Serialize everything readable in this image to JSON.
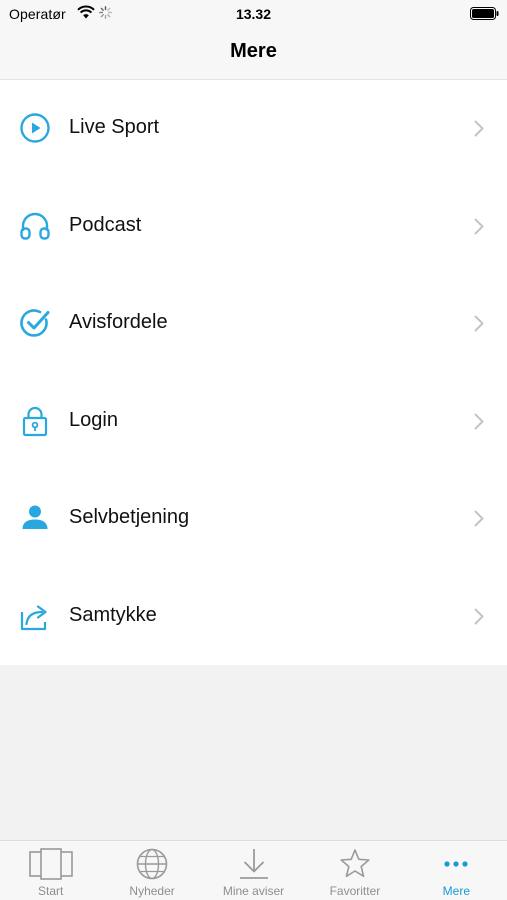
{
  "status_bar": {
    "carrier": "Operatør",
    "time": "13.32"
  },
  "header": {
    "title": "Mere"
  },
  "colors": {
    "accent": "#1a9ad6",
    "icon_blue": "#29a8e0",
    "chevron": "#c4c4c6",
    "tab_inactive": "#8e8e8e"
  },
  "menu": {
    "items": [
      {
        "label": "Live Sport",
        "icon": "play-circle-icon"
      },
      {
        "label": "Podcast",
        "icon": "headphones-icon"
      },
      {
        "label": "Avisfordele",
        "icon": "check-circle-icon"
      },
      {
        "label": "Login",
        "icon": "lock-icon"
      },
      {
        "label": "Selvbetjening",
        "icon": "person-icon"
      },
      {
        "label": "Samtykke",
        "icon": "share-icon"
      }
    ]
  },
  "tabs": [
    {
      "label": "Start",
      "icon": "pages-icon",
      "active": false
    },
    {
      "label": "Nyheder",
      "icon": "globe-icon",
      "active": false
    },
    {
      "label": "Mine aviser",
      "icon": "download-icon",
      "active": false
    },
    {
      "label": "Favoritter",
      "icon": "star-icon",
      "active": false
    },
    {
      "label": "Mere",
      "icon": "more-dots-icon",
      "active": true
    }
  ]
}
